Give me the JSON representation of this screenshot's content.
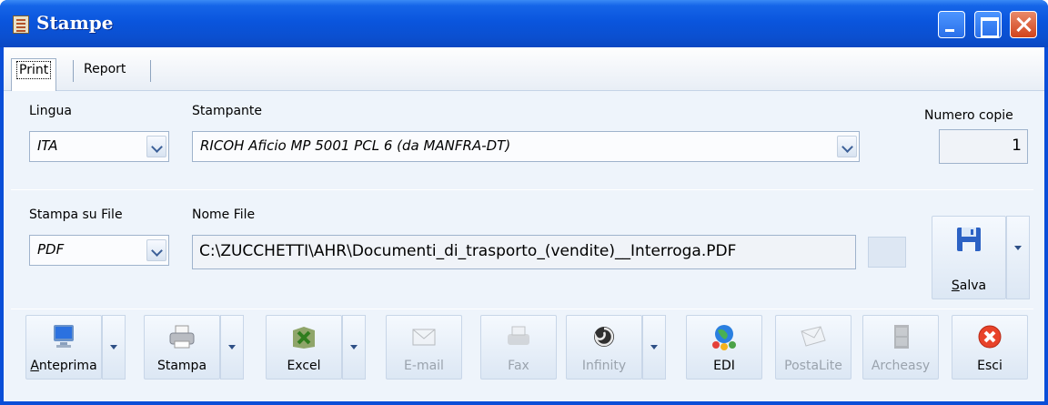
{
  "window": {
    "title": "Stampe"
  },
  "tabs": [
    {
      "label": "Print"
    },
    {
      "label": "Report"
    }
  ],
  "printer_section": {
    "lingua_label": "Lingua",
    "lingua_value": "ITA",
    "stampante_label": "Stampante",
    "stampante_value": "RICOH Aficio MP 5001 PCL 6 (da MANFRA-DT)",
    "copies_label": "Numero copie",
    "copies_value": "1"
  },
  "file_section": {
    "stampa_su_file_label": "Stampa su File",
    "format_value": "PDF",
    "nome_file_label": "Nome File",
    "nome_file_value": "C:\\ZUCCHETTI\\AHR\\Documenti_di_trasporto_(vendite)__Interroga.PDF",
    "salva_label": "Salva",
    "salva_hotkey": "S",
    "salva_rest": "alva"
  },
  "actions": [
    {
      "hotkey": "A",
      "rest": "nteprima",
      "enabled": true,
      "icon": "monitor-icon"
    },
    {
      "hotkey": "",
      "rest": "Stampa",
      "enabled": true,
      "icon": "printer-icon"
    },
    {
      "hotkey": "",
      "rest": "Excel",
      "enabled": true,
      "icon": "excel-icon"
    },
    {
      "hotkey": "",
      "rest": "E-mail",
      "enabled": false,
      "icon": "envelope-icon"
    },
    {
      "hotkey": "",
      "rest": "Fax",
      "enabled": false,
      "icon": "fax-icon"
    },
    {
      "hotkey": "",
      "rest": "Infinity",
      "enabled": false,
      "icon": "infinity-icon"
    },
    {
      "hotkey": "",
      "rest": "EDI",
      "enabled": true,
      "icon": "globe-people-icon"
    },
    {
      "hotkey": "",
      "rest": "PostaLite",
      "enabled": false,
      "icon": "postalite-icon"
    },
    {
      "hotkey": "",
      "rest": "Archeasy",
      "enabled": false,
      "icon": "cabinet-icon"
    },
    {
      "hotkey": "",
      "rest": "Esci",
      "enabled": true,
      "icon": "close-icon"
    }
  ]
}
